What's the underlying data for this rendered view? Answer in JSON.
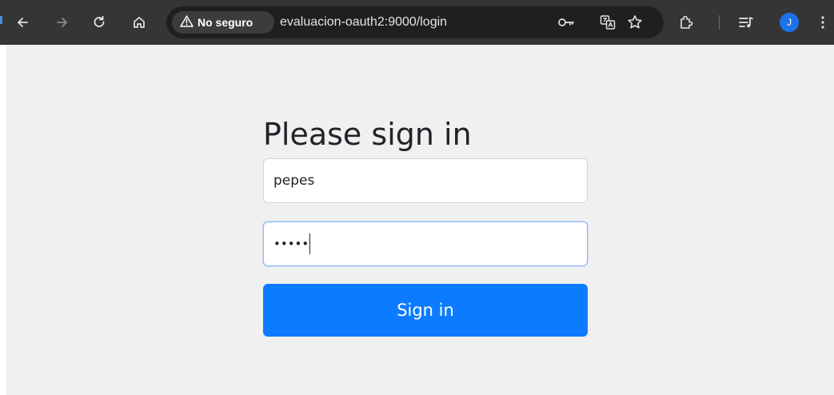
{
  "browser": {
    "security_label": "No seguro",
    "url": "evaluacion-oauth2:9000/login",
    "profile_initial": "J",
    "icons": [
      "back-icon",
      "forward-icon",
      "reload-icon",
      "home-icon",
      "warning-icon",
      "key-icon",
      "translate-icon",
      "star-icon",
      "extensions-icon",
      "media-icon",
      "profile-avatar",
      "menu-icon"
    ]
  },
  "login": {
    "title": "Please sign in",
    "username_value": "pepes",
    "password_mask": "•••••",
    "submit_label": "Sign in"
  },
  "colors": {
    "toolbar_bg": "#353535",
    "page_bg": "#f0f0f0",
    "button_bg": "#0d7bff",
    "avatar_bg": "#1a73e8"
  }
}
